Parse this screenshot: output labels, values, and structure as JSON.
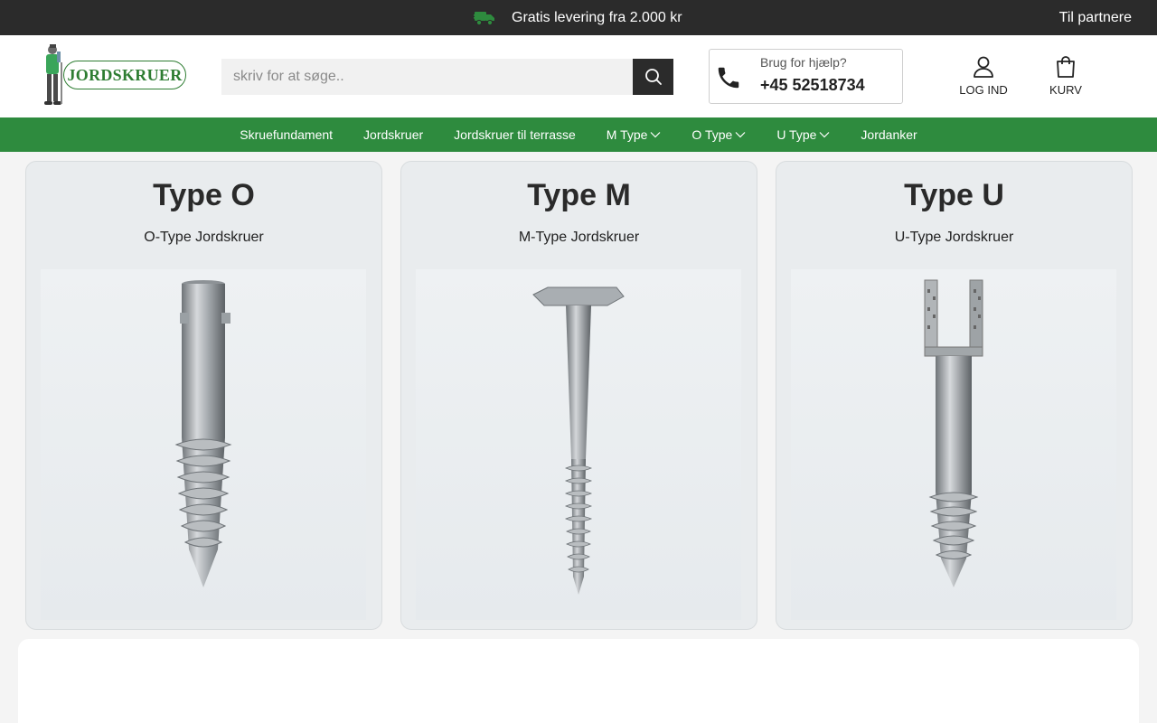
{
  "topbar": {
    "delivery_text": "Gratis levering fra 2.000 kr",
    "delivery_icon": "truck-icon",
    "partner_link": "Til partnere",
    "accent": "#2e8b3e"
  },
  "header": {
    "logo_text": "JORDSKRUER",
    "search": {
      "placeholder": "skriv for at søge..",
      "value": ""
    },
    "help": {
      "label": "Brug for hjælp?",
      "phone": "+45 52518734"
    },
    "account_label": "LOG IND",
    "cart_label": "KURV"
  },
  "nav": {
    "items": [
      {
        "label": "Skruefundament",
        "dropdown": false
      },
      {
        "label": "Jordskruer",
        "dropdown": false
      },
      {
        "label": "Jordskruer til terrasse",
        "dropdown": false
      },
      {
        "label": "M Type",
        "dropdown": true
      },
      {
        "label": "O Type",
        "dropdown": true
      },
      {
        "label": "U Type",
        "dropdown": true
      },
      {
        "label": "Jordanker",
        "dropdown": false
      }
    ]
  },
  "cards": [
    {
      "title": "Type O",
      "subtitle": "O-Type Jordskruer"
    },
    {
      "title": "Type M",
      "subtitle": "M-Type Jordskruer"
    },
    {
      "title": "Type U",
      "subtitle": "U-Type Jordskruer"
    }
  ]
}
